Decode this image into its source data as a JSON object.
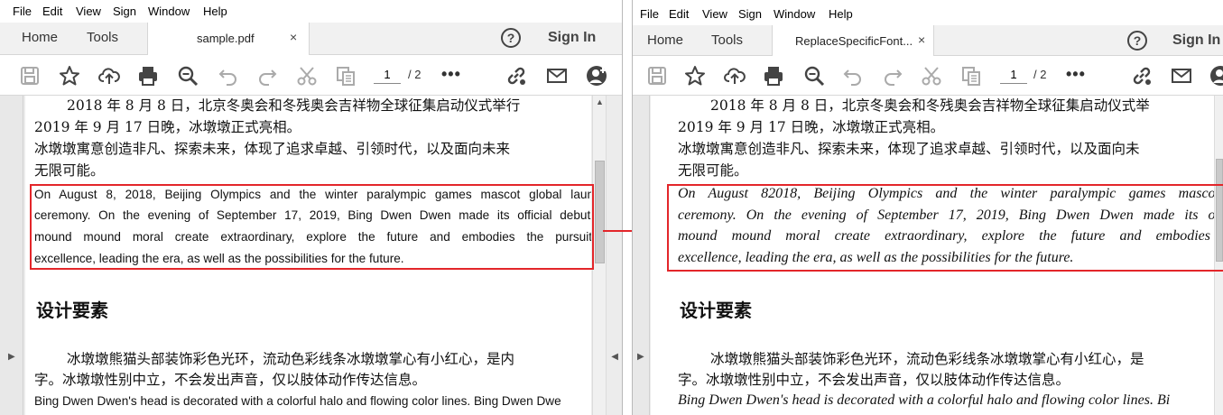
{
  "menu": [
    "File",
    "Edit",
    "View",
    "Sign",
    "Window",
    "Help"
  ],
  "left": {
    "tabs": {
      "home": "Home",
      "tools": "Tools",
      "doc_title": "sample.pdf",
      "close": "×"
    },
    "sign_in": "Sign In",
    "page_current": "1",
    "page_total": "/ 2",
    "content": {
      "cn1_line1": "2018 年 8 月 8 日，北京冬奥会和冬残奥会吉祥物全球征集启动仪式举行",
      "cn1_line2": "2019 年 9 月 17 日晚，冰墩墩正式亮相。",
      "cn1_line3": "冰墩墩寓意创造非凡、探索未来，体现了追求卓越、引领时代，以及面向未来",
      "cn1_line4": "无限可能。",
      "en1_line1": "On August 8, 2018, Beijing Olympics and the winter paralympic games mascot global laun",
      "en1_line2": "ceremony. On the evening of September 17, 2019, Bing Dwen Dwen made its official debut.",
      "en1_line3": "mound mound moral create extraordinary, explore the future and embodies the pursuit",
      "en1_line4": "excellence, leading the era, as well as the possibilities for the future.",
      "heading": "设计要素",
      "cn2_line1": "冰墩墩熊猫头部装饰彩色光环，流动色彩线条冰墩墩掌心有小红心，是内",
      "cn2_line2": "字。冰墩墩性别中立，不会发出声音，仅以肢体动作传达信息。",
      "en2_line1": "Bing Dwen Dwen's head is decorated with a colorful halo and flowing color lines. Bing Dwen Dwe"
    }
  },
  "right": {
    "tabs": {
      "home": "Home",
      "tools": "Tools",
      "doc_title": "ReplaceSpecificFont...",
      "close": "×"
    },
    "sign_in": "Sign In",
    "page_current": "1",
    "page_total": "/ 2",
    "content": {
      "cn1_line1": "2018 年 8 月 8 日，北京冬奥会和冬残奥会吉祥物全球征集启动仪式举",
      "cn1_line2": "2019 年 9 月 17 日晚，冰墩墩正式亮相。",
      "cn1_line3": "冰墩墩寓意创造非凡、探索未来，体现了追求卓越、引领时代，以及面向未",
      "cn1_line4": "无限可能。",
      "en1_line1": "On August 82018, Beijing Olympics and the winter paralympic games mascot",
      "en1_line2": "ceremony. On the evening of September 17, 2019, Bing Dwen Dwen made its of",
      "en1_line3": "mound mound moral create extraordinary, explore the future and embodies",
      "en1_line4": "excellence, leading the era, as well as the possibilities for the future.",
      "heading": "设计要素",
      "cn2_line1": "冰墩墩熊猫头部装饰彩色光环，流动色彩线条冰墩墩掌心有小红心，是",
      "cn2_line2": "字。冰墩墩性别中立，不会发出声音，仅以肢体动作传达信息。",
      "en2_line1": "Bing Dwen Dwen's head is decorated with a colorful halo and flowing color lines. Bi"
    }
  },
  "colors": {
    "highlight": "#e3262a",
    "tabbar": "#f1f1f1",
    "viewer_bg": "#ececec"
  },
  "icons": [
    "save-icon",
    "bookmark-star-icon",
    "upload-cloud-icon",
    "print-icon",
    "zoom-icon",
    "undo-icon",
    "redo-icon",
    "scissors-icon",
    "copy-icon",
    "more-icon",
    "link-icon",
    "mail-icon",
    "add-user-icon",
    "help-icon",
    "arrow-right-icon"
  ]
}
